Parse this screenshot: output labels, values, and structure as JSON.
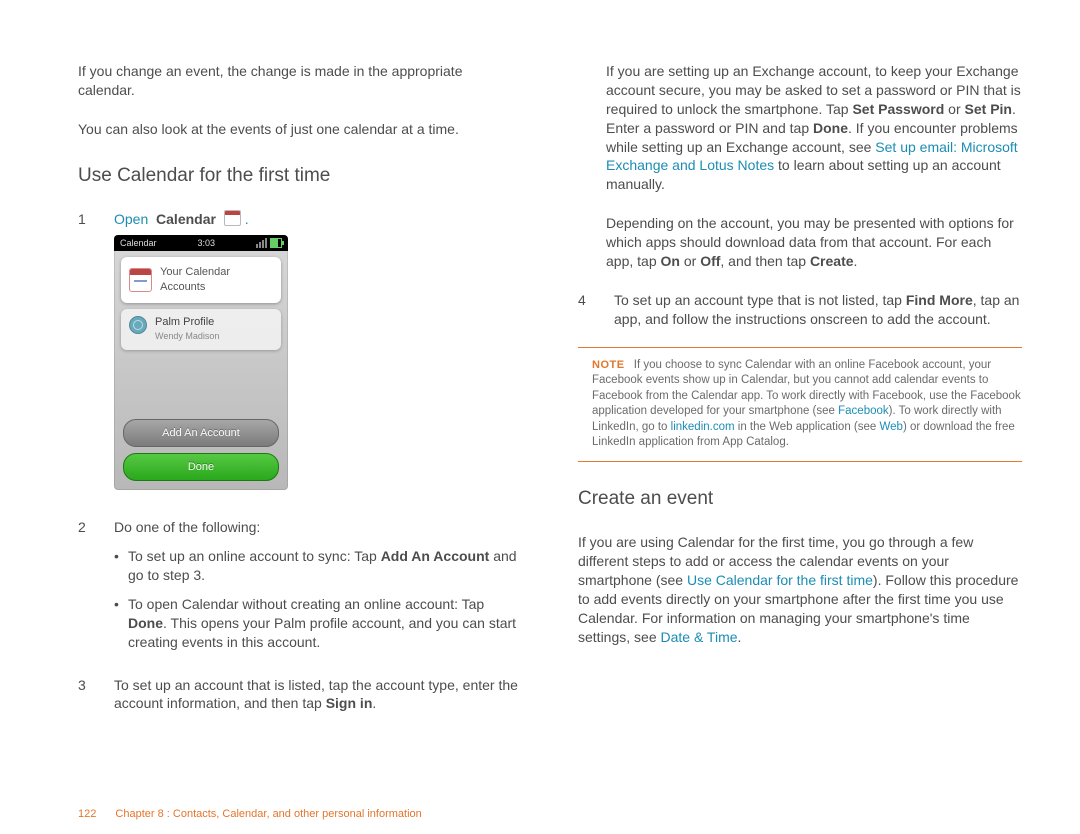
{
  "left": {
    "intro1": "If you change an event, the change is made in the appropriate calendar.",
    "intro2": "You can also look at the events of just one calendar at a time.",
    "heading": "Use Calendar for the first time",
    "step1_link": "Open",
    "step1_bold": "Calendar",
    "shot": {
      "status_left": "Calendar",
      "status_time": "3:03",
      "card_title": "Your Calendar Accounts",
      "item_name": "Palm Profile",
      "item_sub": "Wendy Madison",
      "btn_add": "Add An Account",
      "btn_done": "Done"
    },
    "step2_lead": "Do one of the following:",
    "bullet1_a": "To set up an online account to sync: Tap ",
    "bullet1_b": "Add An Account",
    "bullet1_c": " and go to step 3.",
    "bullet2_a": "To open Calendar without creating an online account: Tap ",
    "bullet2_b": "Done",
    "bullet2_c": ". This opens your Palm profile account, and you can start creating events in this account.",
    "step3_a": "To set up an account that is listed, tap the account type, enter the account information, and then tap ",
    "step3_b": "Sign in",
    "step3_c": "."
  },
  "right": {
    "p1_a": "If you are setting up an Exchange account, to keep your Exchange account secure, you may be asked to set a password or PIN that is required to unlock the smartphone. Tap ",
    "p1_b": "Set Password",
    "p1_c": " or ",
    "p1_d": "Set Pin",
    "p1_e": ". Enter a password or PIN and tap ",
    "p1_f": "Done",
    "p1_g": ". If you encounter problems while setting up an Exchange account, see ",
    "p1_link": "Set up email: Microsoft Exchange and Lotus Notes",
    "p1_h": " to learn about setting up an account manually.",
    "p2_a": "Depending on the account, you may be presented with options for which apps should download data from that account. For each app, tap ",
    "p2_on": "On",
    "p2_or": " or ",
    "p2_off": "Off",
    "p2_then": ", and then tap ",
    "p2_create": "Create",
    "p2_end": ".",
    "step4_a": "To set up an account type that is not listed, tap ",
    "step4_b": "Find More",
    "step4_c": ", tap an app, and follow the instructions onscreen to add the account.",
    "note_label": "NOTE",
    "note_a": "If you choose to sync Calendar with an online Facebook account, your Facebook events show up in Calendar, but you cannot add calendar events to Facebook from the Calendar app. To work directly with Facebook, use the Facebook application developed for your smartphone (see ",
    "note_fb": "Facebook",
    "note_b": "). To work directly with LinkedIn, go to ",
    "note_li": "linkedin.com",
    "note_c": " in the Web application (see ",
    "note_web": "Web",
    "note_d": ") or download the free LinkedIn application from App Catalog.",
    "heading2": "Create an event",
    "p3_a": "If you are using Calendar for the first time, you go through a few different steps to add or access the calendar events on your smartphone (see ",
    "p3_link1": "Use Calendar for the first time",
    "p3_b": "). Follow this procedure to add events directly on your smartphone after the first time you use Calendar. For information on managing your smartphone's time settings, see ",
    "p3_link2": "Date & Time",
    "p3_c": "."
  },
  "footer": {
    "page": "122",
    "chapter": "Chapter 8 : Contacts, Calendar, and other personal information"
  }
}
